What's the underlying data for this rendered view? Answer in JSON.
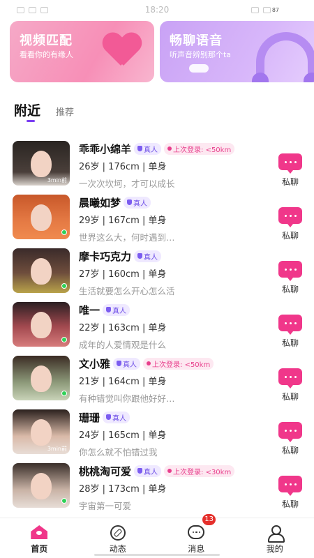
{
  "status_bar": {
    "time": "18:20",
    "battery": "87"
  },
  "banners": [
    {
      "title": "视频匹配",
      "subtitle": "看看你的有缘人",
      "color": "#f78fb7"
    },
    {
      "title": "畅聊语音",
      "subtitle": "听声音辨别那个ta",
      "color": "#d8b7fa"
    }
  ],
  "tabs": {
    "active": "附近",
    "inactive": "推荐"
  },
  "users": [
    {
      "name": "乖乖小绵羊",
      "verified": "真人",
      "last_login": "上次登录: <50km",
      "meta": "26岁 | 176cm | 单身",
      "bio": "一次次坎坷，才可以成长",
      "avatar_tag": "3min前",
      "chat": "私聊"
    },
    {
      "name": "晨曦如梦",
      "verified": "真人",
      "last_login": "",
      "meta": "29岁 | 167cm | 单身",
      "bio": "世界这么大，何时遇到…",
      "avatar_tag": "",
      "chat": "私聊"
    },
    {
      "name": "摩卡巧克力",
      "verified": "真人",
      "last_login": "",
      "meta": "27岁 | 160cm | 单身",
      "bio": "生活就要怎么开心怎么活",
      "avatar_tag": "",
      "chat": "私聊"
    },
    {
      "name": "唯一",
      "verified": "真人",
      "last_login": "",
      "meta": "22岁 | 163cm | 单身",
      "bio": "成年的人爱情观是什么",
      "avatar_tag": "",
      "chat": "私聊"
    },
    {
      "name": "文小雅",
      "verified": "真人",
      "last_login": "上次登录: <50km",
      "meta": "21岁 | 164cm | 单身",
      "bio": "有种错觉叫你跟他好好…",
      "avatar_tag": "",
      "chat": "私聊"
    },
    {
      "name": "珊珊",
      "verified": "真人",
      "last_login": "",
      "meta": "24岁 | 165cm | 单身",
      "bio": "你怎么就不怕错过我",
      "avatar_tag": "3min前",
      "chat": "私聊"
    },
    {
      "name": "桃桃淘可爱",
      "verified": "真人",
      "last_login": "上次登录: <30km",
      "meta": "28岁 | 173cm | 单身",
      "bio": "宇宙第一可爱",
      "avatar_tag": "",
      "chat": "私聊"
    }
  ],
  "bottom_nav": [
    {
      "label": "首页",
      "icon": "home-icon"
    },
    {
      "label": "动态",
      "icon": "compass-icon"
    },
    {
      "label": "消息",
      "icon": "message-icon",
      "badge": "13"
    },
    {
      "label": "我的",
      "icon": "user-icon"
    }
  ],
  "colors": {
    "accent": "#f0378a",
    "verify": "#7b5cf0",
    "tab_indicator": "#7b3ff2",
    "online": "#2fd157"
  }
}
